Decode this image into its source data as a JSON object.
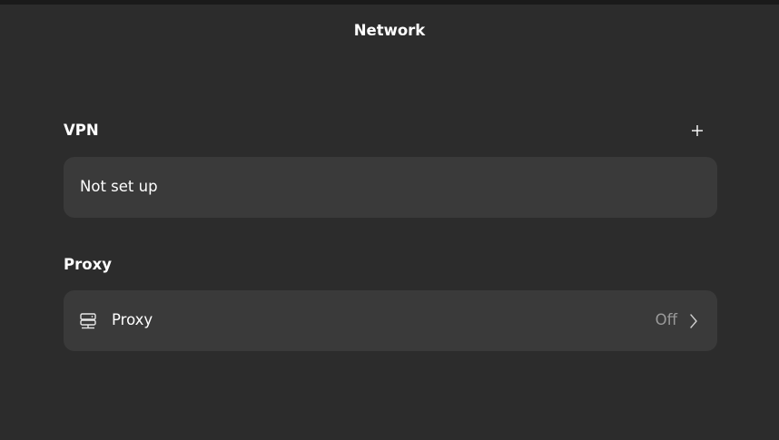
{
  "header": {
    "title": "Network"
  },
  "vpn": {
    "section_title": "VPN",
    "add_label": "+",
    "status_text": "Not set up"
  },
  "proxy": {
    "section_title": "Proxy",
    "row_label": "Proxy",
    "status": "Off",
    "icon": "network-server-icon",
    "chevron_icon": "chevron-right-icon"
  },
  "colors": {
    "background": "#2c2c2c",
    "card": "#3a3a3a",
    "text": "#ffffff",
    "secondary_text": "#9a9a9a"
  }
}
